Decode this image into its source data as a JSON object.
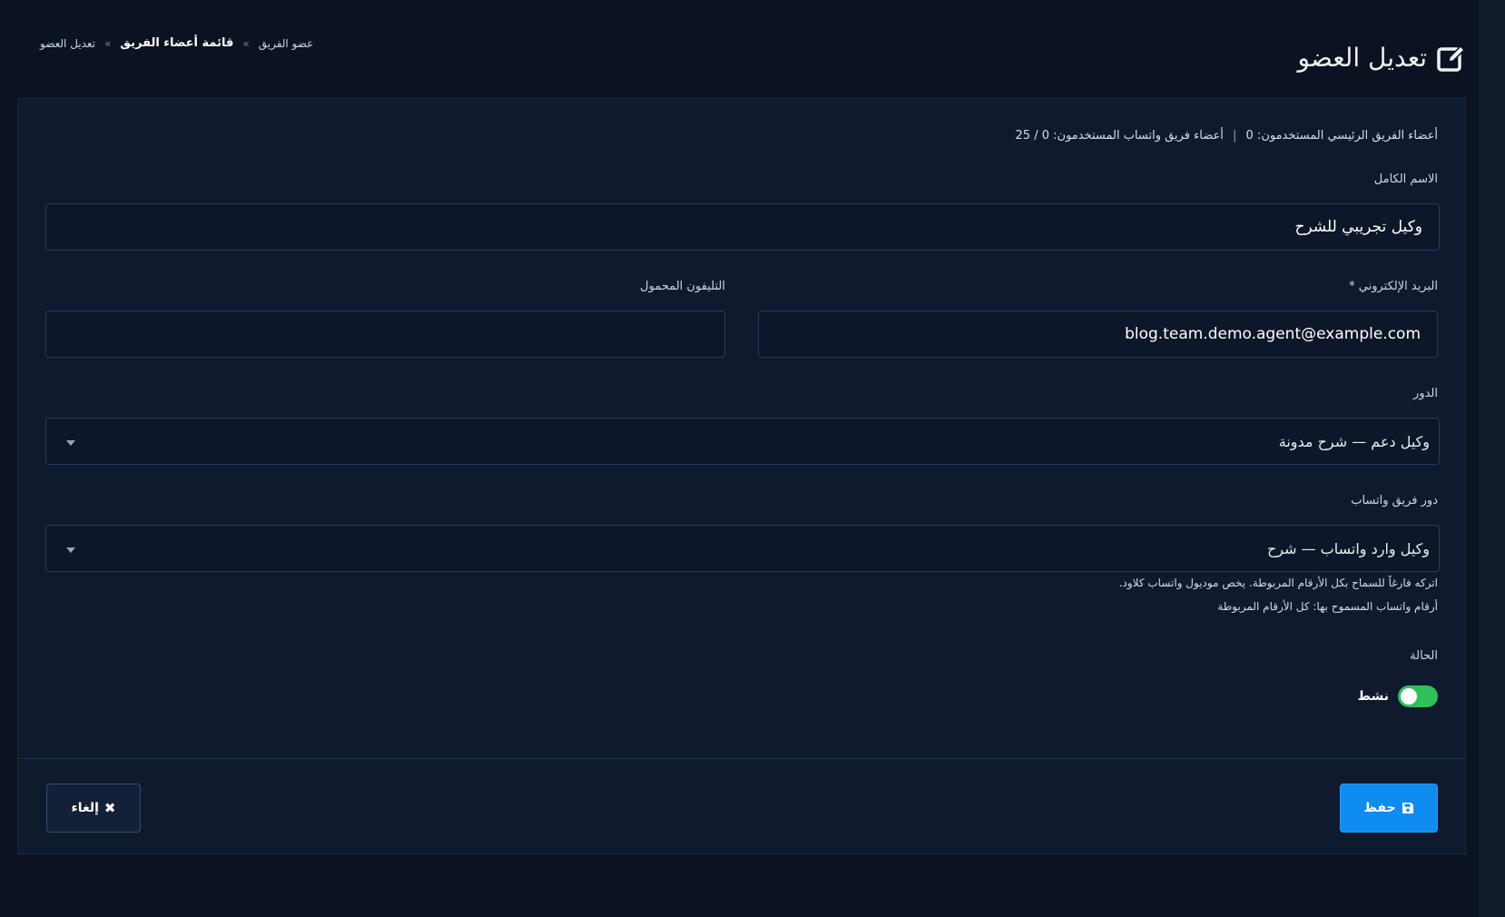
{
  "header": {
    "title": "تعديل العضو",
    "icon": "edit-icon"
  },
  "breadcrumb": {
    "items": [
      "عضو الفريق",
      "قائمة أعضاء الفريق",
      "تعديل العضو"
    ],
    "separator": "»"
  },
  "info": {
    "main_members_label": "أعضاء الفريق الرئيسي المستخدمون: 0",
    "separator": "|",
    "whatsapp_members_label": "أعضاء فريق واتساب المستخدمون: 0 / 25"
  },
  "form": {
    "full_name": {
      "label": "الاسم الكامل",
      "value": "وكيل تجريبي للشرح"
    },
    "email": {
      "label": "البريد الإلكتروني *",
      "value": "blog.team.demo.agent@example.com"
    },
    "mobile": {
      "label": "التليفون المحمول",
      "value": ""
    },
    "role": {
      "label": "الدور",
      "selected": "وكيل دعم — شرح مدونة"
    },
    "whatsapp_role": {
      "label": "دور فريق واتساب",
      "selected": "وكيل وارد واتساب — شرح",
      "help": "اتركه فارغاً للسماح بكل الأرقام المربوطة. يخص موديول واتساب كلاود.",
      "allowed_numbers": "أرقام واتساب المسموح بها: كل الأرقام المربوطة"
    },
    "status": {
      "label": "الحالة",
      "toggle_label": "نشط",
      "active": true,
      "toggle_color": "#2fc05a"
    }
  },
  "actions": {
    "save_label": "حفظ",
    "save_icon": "floppy-disk-icon",
    "cancel_label": "إلغاء",
    "cancel_icon": "close-icon",
    "accent": "#0f8cf0"
  }
}
